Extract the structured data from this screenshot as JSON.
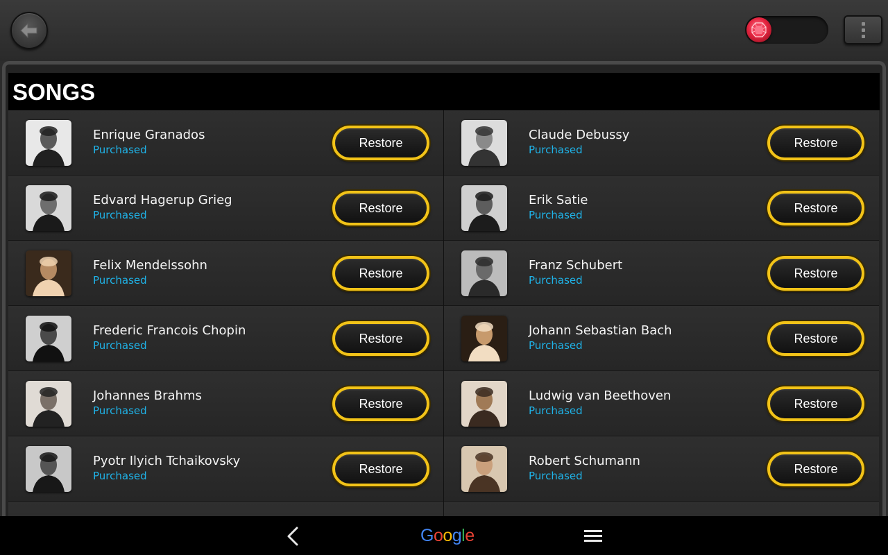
{
  "header": {
    "back_icon": "back-arrow-icon",
    "gem_icon": "ruby-gem-icon",
    "menu_icon": "vertical-dots-icon"
  },
  "panel": {
    "title": "SONGS"
  },
  "songs": {
    "left": [
      {
        "name": "Enrique Granados",
        "status": "Purchased",
        "action": "Restore"
      },
      {
        "name": "Edvard Hagerup Grieg",
        "status": "Purchased",
        "action": "Restore"
      },
      {
        "name": "Felix Mendelssohn",
        "status": "Purchased",
        "action": "Restore"
      },
      {
        "name": "Frederic Francois Chopin",
        "status": "Purchased",
        "action": "Restore"
      },
      {
        "name": "Johannes Brahms",
        "status": "Purchased",
        "action": "Restore"
      },
      {
        "name": "Pyotr Ilyich Tchaikovsky",
        "status": "Purchased",
        "action": "Restore"
      }
    ],
    "right": [
      {
        "name": "Claude Debussy",
        "status": "Purchased",
        "action": "Restore"
      },
      {
        "name": "Erik Satie",
        "status": "Purchased",
        "action": "Restore"
      },
      {
        "name": "Franz Schubert",
        "status": "Purchased",
        "action": "Restore"
      },
      {
        "name": "Johann Sebastian Bach",
        "status": "Purchased",
        "action": "Restore"
      },
      {
        "name": "Ludwig van Beethoven",
        "status": "Purchased",
        "action": "Restore"
      },
      {
        "name": "Robert Schumann",
        "status": "Purchased",
        "action": "Restore"
      }
    ]
  },
  "navbar": {
    "back_icon": "nav-back-chevron-icon",
    "logo": "Google",
    "menu_icon": "hamburger-menu-icon"
  },
  "colors": {
    "accent_yellow": "#f2c318",
    "status_blue": "#1fb3e8",
    "gem_red": "#e4243f"
  }
}
